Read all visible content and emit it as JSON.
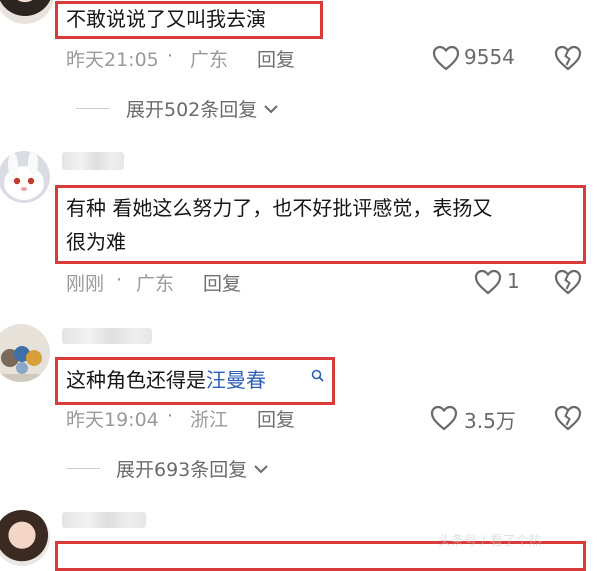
{
  "comments": [
    {
      "text": "不敢说说了又叫我去演",
      "time": "昨天21:05",
      "location": "广东",
      "reply_label": "回复",
      "likes": "9554",
      "expand_label": "展开502条回复"
    },
    {
      "text_line1": "有种 看她这么努力了，也不好批评感觉，表扬又",
      "text_line2": "很为难",
      "time": "刚刚",
      "location": "广东",
      "reply_label": "回复",
      "likes": "1"
    },
    {
      "text_prefix": "这种角色还得是",
      "text_link": "汪曼春",
      "time": "昨天19:04",
      "location": "浙江",
      "reply_label": "回复",
      "likes": "3.5万",
      "expand_label": "展开693条回复"
    }
  ],
  "separator": "·",
  "watermark": "头条号 / 看了个热",
  "colors": {
    "highlight_border": "#d93a3a",
    "link": "#2d5fb8",
    "meta_text": "#9a9a9a"
  },
  "icons": [
    "heart-outline-icon",
    "broken-heart-icon",
    "search-icon",
    "chevron-down-icon"
  ]
}
